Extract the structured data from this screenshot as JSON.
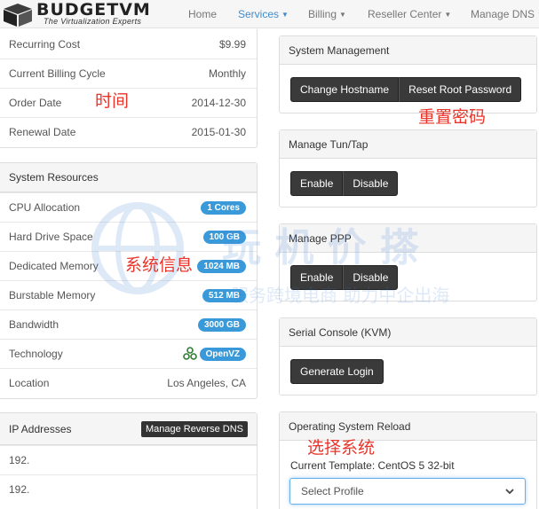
{
  "brand": {
    "name": "BUDGETVM",
    "tagline": "The Virtualization Experts"
  },
  "nav": {
    "home": "Home",
    "services": "Services",
    "billing": "Billing",
    "reseller": "Reseller Center",
    "dns": "Manage DNS"
  },
  "billing_info": {
    "rows": [
      {
        "label": "Recurring Cost",
        "value": "$9.99"
      },
      {
        "label": "Current Billing Cycle",
        "value": "Monthly"
      },
      {
        "label": "Order Date",
        "value": "2014-12-30"
      },
      {
        "label": "Renewal Date",
        "value": "2015-01-30"
      }
    ]
  },
  "system_resources": {
    "title": "System Resources",
    "rows": [
      {
        "label": "CPU Allocation",
        "badge": "1 Cores"
      },
      {
        "label": "Hard Drive Space",
        "badge": "100 GB"
      },
      {
        "label": "Dedicated Memory",
        "badge": "1024 MB"
      },
      {
        "label": "Burstable Memory",
        "badge": "512 MB"
      },
      {
        "label": "Bandwidth",
        "badge": "3000 GB"
      },
      {
        "label": "Technology",
        "badge": "OpenVZ"
      },
      {
        "label": "Location",
        "value": "Los Angeles, CA"
      }
    ]
  },
  "ip_addresses": {
    "title": "IP Addresses",
    "manage_rdns": "Manage Reverse DNS",
    "items": [
      "192.",
      "192."
    ]
  },
  "system_management": {
    "title": "System Management",
    "change_hostname": "Change Hostname",
    "reset_root_password": "Reset Root Password"
  },
  "tun_tap": {
    "title": "Manage Tun/Tap",
    "enable": "Enable",
    "disable": "Disable"
  },
  "ppp": {
    "title": "Manage PPP",
    "enable": "Enable",
    "disable": "Disable"
  },
  "serial_console": {
    "title": "Serial Console (KVM)",
    "generate_login": "Generate Login"
  },
  "os_reload": {
    "title": "Operating System Reload",
    "current_template": "Current Template: CentOS 5 32-bit",
    "select_placeholder": "Select Profile"
  },
  "annotations": {
    "time": "时间",
    "reset_password": "重置密码",
    "system_info": "系统信息",
    "choose_system": "选择系统"
  },
  "watermark": {
    "brand": "玩 机 价 搽",
    "slogan": "服务跨境电商 助力中企出海"
  },
  "colors": {
    "accent": "#428bca",
    "badge": "#3a9ad9",
    "annotation": "#e8342a",
    "button": "#3a3a3a"
  }
}
